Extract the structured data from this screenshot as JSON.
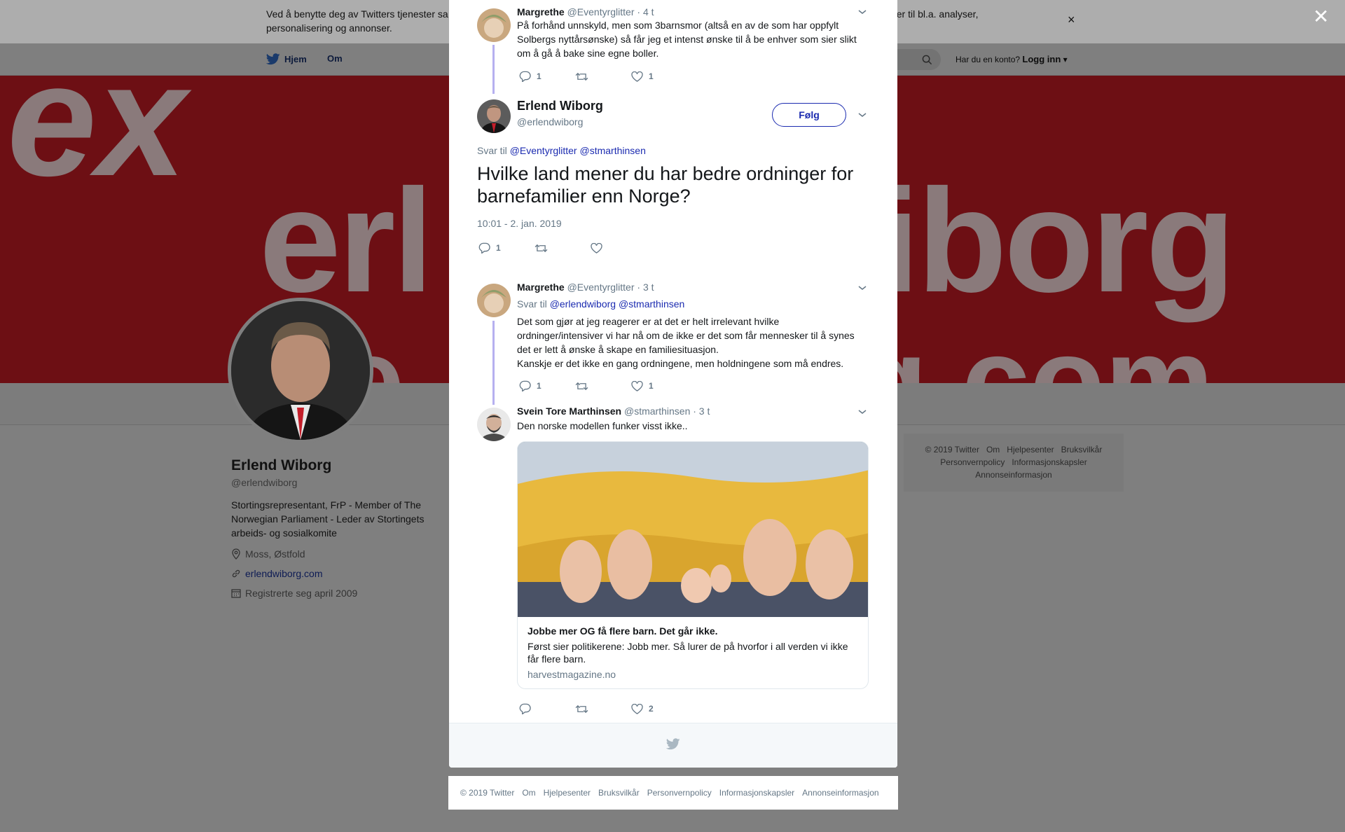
{
  "cookie": {
    "text": "Ved å benytte deg av Twitters tjenester samtykker du i vår bruk av informasjonskapsler til bl.a. analyser, personalisering og annonser.",
    "text_left": "Ved å benytte deg av Twitters tjenester sa",
    "text_right": "informasjonskapsler til bl.a. analyser,",
    "text_line2": "personalisering og annonser."
  },
  "nav": {
    "home": "Hjem",
    "about": "Om",
    "login_prompt": "Har du en konto?",
    "login": "Logg inn"
  },
  "profile": {
    "name": "Erlend Wiborg",
    "handle": "@erlendwiborg",
    "bio": "Stortingsrepresentant, FrP - Member of The Norwegian Parliament - Leder av Stortingets arbeids- og sosialkomite",
    "location": "Moss, Østfold",
    "website": "erlendwiborg.com",
    "joined": "Registrerte seg april 2009"
  },
  "side_footer": [
    "© 2019 Twitter",
    "Om",
    "Hjelpesenter",
    "Bruksvilkår",
    "Personvernpolicy",
    "Informasjonskapsler",
    "Annonseinformasjon"
  ],
  "thread": {
    "t1": {
      "name": "Margrethe",
      "handle": "@Eventyrglitter",
      "time": "· 4 t",
      "text": "På forhånd unnskyld, men som 3barnsmor (altså en av de som har oppfylt Solbergs nyttårsønske) så får jeg et intenst ønske til å be enhver som sier slikt om å gå å bake sine egne boller.",
      "replies": "1",
      "likes": "1"
    },
    "main": {
      "name": "Erlend Wiborg",
      "handle": "@erlendwiborg",
      "follow": "Følg",
      "reply_to_label": "Svar til",
      "reply_to_1": "@Eventyrglitter",
      "reply_to_2": "@stmarthinsen",
      "text": "Hvilke land mener du har bedre ordninger for barnefamilier enn Norge?",
      "time": "10:01 - 2. jan. 2019",
      "replies": "1"
    },
    "t2": {
      "name": "Margrethe",
      "handle": "@Eventyrglitter",
      "time": "· 3 t",
      "reply_to_label": "Svar til",
      "reply_to_1": "@erlendwiborg",
      "reply_to_2": "@stmarthinsen",
      "text": "Det som gjør at jeg reagerer er at det er helt irrelevant hvilke ordninger/intensiver vi har nå  om de ikke er det som får mennesker til å synes det er lett å ønske å skape en familiesituasjon.",
      "text2": "Kanskje er det ikke en gang ordningene, men holdningene som må endres.",
      "replies": "1",
      "likes": "1"
    },
    "t3": {
      "name": "Svein Tore Marthinsen",
      "handle": "@stmarthinsen",
      "time": "· 3 t",
      "text": "Den norske modellen funker visst ikke..",
      "card_title": "Jobbe mer OG få flere barn. Det går ikke.",
      "card_desc": "Først sier politikerene: Jobb mer. Så lurer de på hvorfor i all verden vi ikke får flere barn.",
      "card_url": "harvestmagazine.no",
      "likes": "2"
    }
  },
  "footer": [
    "© 2019 Twitter",
    "Om",
    "Hjelpesenter",
    "Bruksvilkår",
    "Personvernpolicy",
    "Informasjonskapsler",
    "Annonseinformasjon"
  ],
  "colors": {
    "link": "#1b2bb0",
    "thread_line": "#b6b0f0",
    "banner": "#6d0f14"
  },
  "icons": [
    "twitter-bird-icon",
    "search-icon",
    "close-icon",
    "reply-icon",
    "retweet-icon",
    "like-icon",
    "chevron-down-icon",
    "location-icon",
    "link-icon",
    "calendar-icon"
  ]
}
